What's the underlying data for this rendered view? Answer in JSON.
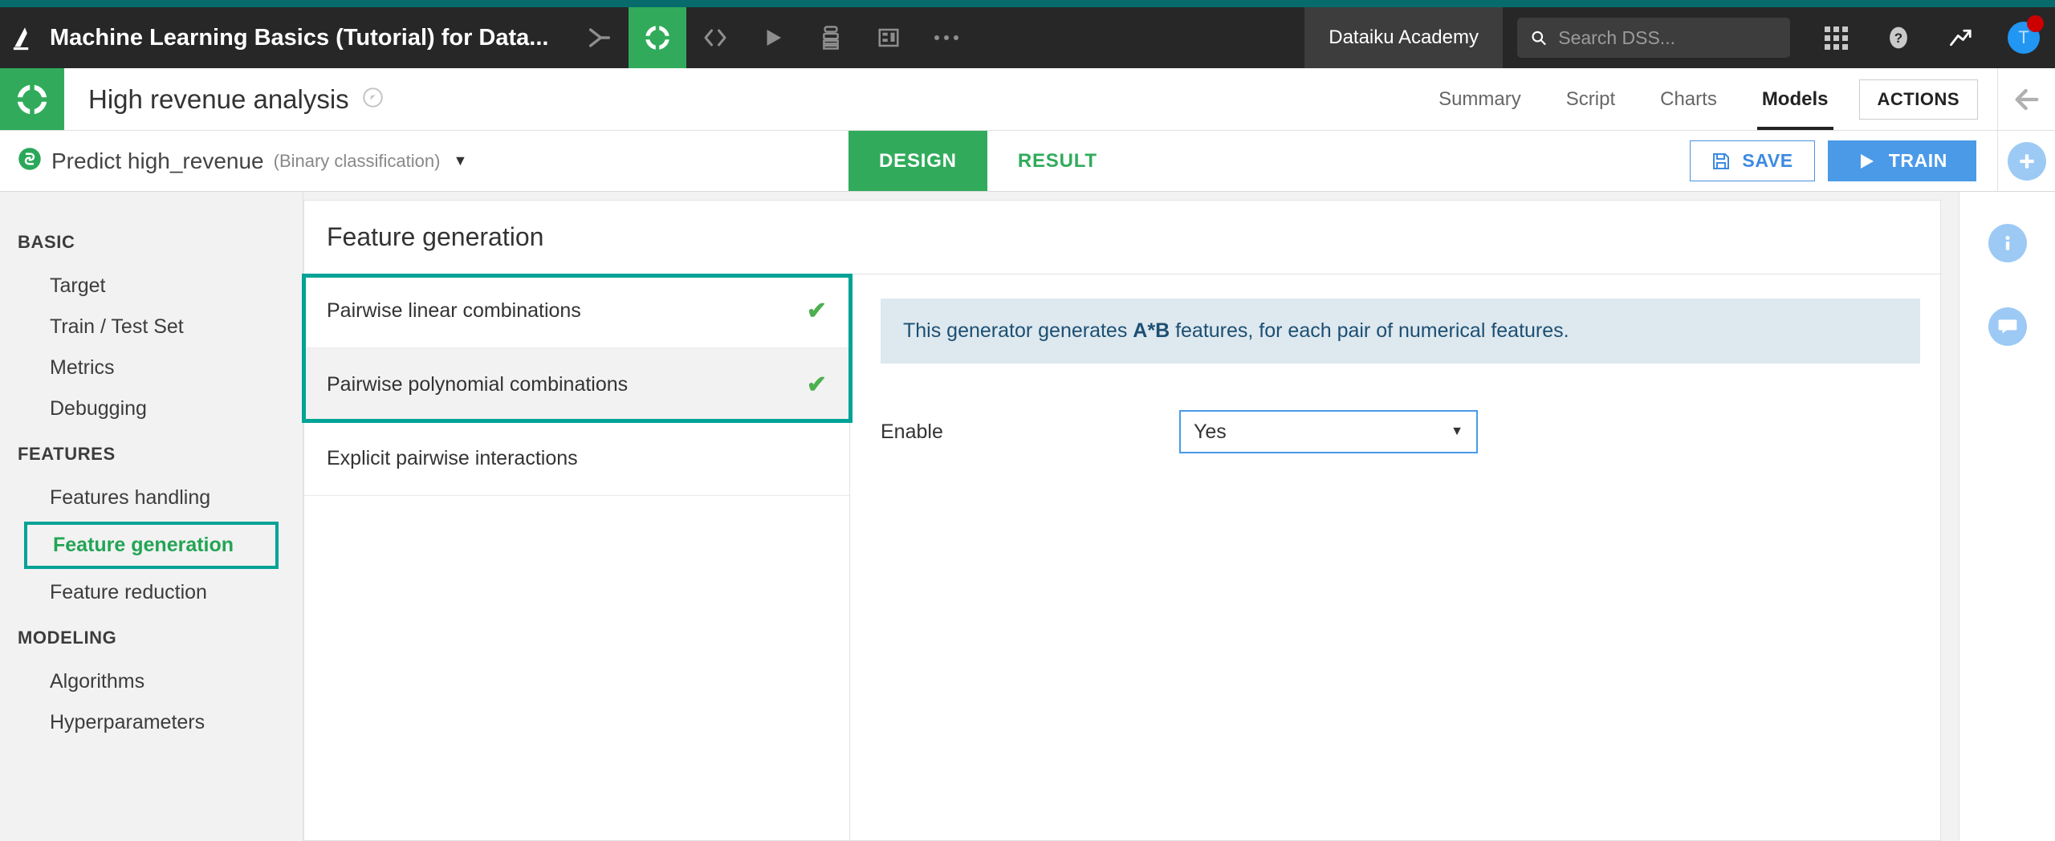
{
  "topbar": {
    "logo_icon": "dataiku-bird-icon",
    "project_title": "Machine Learning Basics (Tutorial) for Data...",
    "icons": [
      {
        "name": "flow-icon",
        "glyph": "flow"
      },
      {
        "name": "dataiku-icon",
        "glyph": "dataiku"
      },
      {
        "name": "code-icon",
        "glyph": "</>"
      },
      {
        "name": "run-icon",
        "glyph": "play"
      },
      {
        "name": "jobs-icon",
        "glyph": "jobs"
      },
      {
        "name": "dashboard-icon",
        "glyph": "dashboard"
      },
      {
        "name": "more-icon",
        "glyph": "..."
      }
    ],
    "academy_label": "Dataiku Academy",
    "search_placeholder": "Search DSS...",
    "search_value": "",
    "apps_icon": "apps-grid-icon",
    "help_icon": "help-icon",
    "activity_icon": "trending-up-icon",
    "avatar_initial": "T",
    "notification_badge": ""
  },
  "project_header": {
    "logo_icon": "project-logo-icon",
    "title": "High revenue analysis",
    "status_icon": "compass-icon",
    "tabs": [
      {
        "label": "Summary",
        "active": false
      },
      {
        "label": "Script",
        "active": false
      },
      {
        "label": "Charts",
        "active": false
      },
      {
        "label": "Models",
        "active": true
      }
    ],
    "actions_label": "ACTIONS",
    "collapse_icon": "arrow-left-icon"
  },
  "model_bar": {
    "model_icon": "prediction-icon",
    "model_name": "Predict high_revenue",
    "model_type": "(Binary classification)",
    "dropdown_caret": "▼",
    "tabs": [
      {
        "label": "DESIGN",
        "active": true
      },
      {
        "label": "RESULT",
        "active": false
      }
    ],
    "save_label": "SAVE",
    "save_icon": "floppy-disk-icon",
    "train_label": "TRAIN",
    "train_icon": "play-icon"
  },
  "sidebar": {
    "groups": [
      {
        "label": "BASIC",
        "items": [
          {
            "label": "Target",
            "selected": false
          },
          {
            "label": "Train / Test Set",
            "selected": false
          },
          {
            "label": "Metrics",
            "selected": false
          },
          {
            "label": "Debugging",
            "selected": false
          }
        ]
      },
      {
        "label": "FEATURES",
        "items": [
          {
            "label": "Features handling",
            "selected": false
          },
          {
            "label": "Feature generation",
            "selected": true
          },
          {
            "label": "Feature reduction",
            "selected": false
          }
        ]
      },
      {
        "label": "MODELING",
        "items": [
          {
            "label": "Algorithms",
            "selected": false
          },
          {
            "label": "Hyperparameters",
            "selected": false
          }
        ]
      }
    ]
  },
  "panel": {
    "title": "Feature generation",
    "generators": [
      {
        "label": "Pairwise linear combinations",
        "enabled": true,
        "check": "✔"
      },
      {
        "label": "Pairwise polynomial combinations",
        "enabled": true,
        "check": "✔"
      },
      {
        "label": "Explicit pairwise interactions",
        "enabled": false,
        "check": ""
      }
    ],
    "detail": {
      "info_prefix": "This generator generates ",
      "info_bold": "A*B",
      "info_suffix": " features, for each pair of numerical features.",
      "enable_label": "Enable",
      "enable_value": "Yes",
      "enable_caret": "▼"
    }
  },
  "right_rail": {
    "items": [
      {
        "name": "add-icon",
        "glyph": "✚"
      },
      {
        "name": "info-icon",
        "glyph": "i"
      },
      {
        "name": "discussion-icon",
        "glyph": "●"
      }
    ]
  },
  "colors": {
    "teal_strip": "#076b6b",
    "topbar_bg": "#272727",
    "green_accent": "#31ab5b",
    "highlight_teal": "#00a396",
    "blue_accent": "#4a9ae8",
    "info_banner_bg": "#dde8ef",
    "info_banner_text": "#1d4f72",
    "sidebar_bg": "#f2f2f2"
  }
}
